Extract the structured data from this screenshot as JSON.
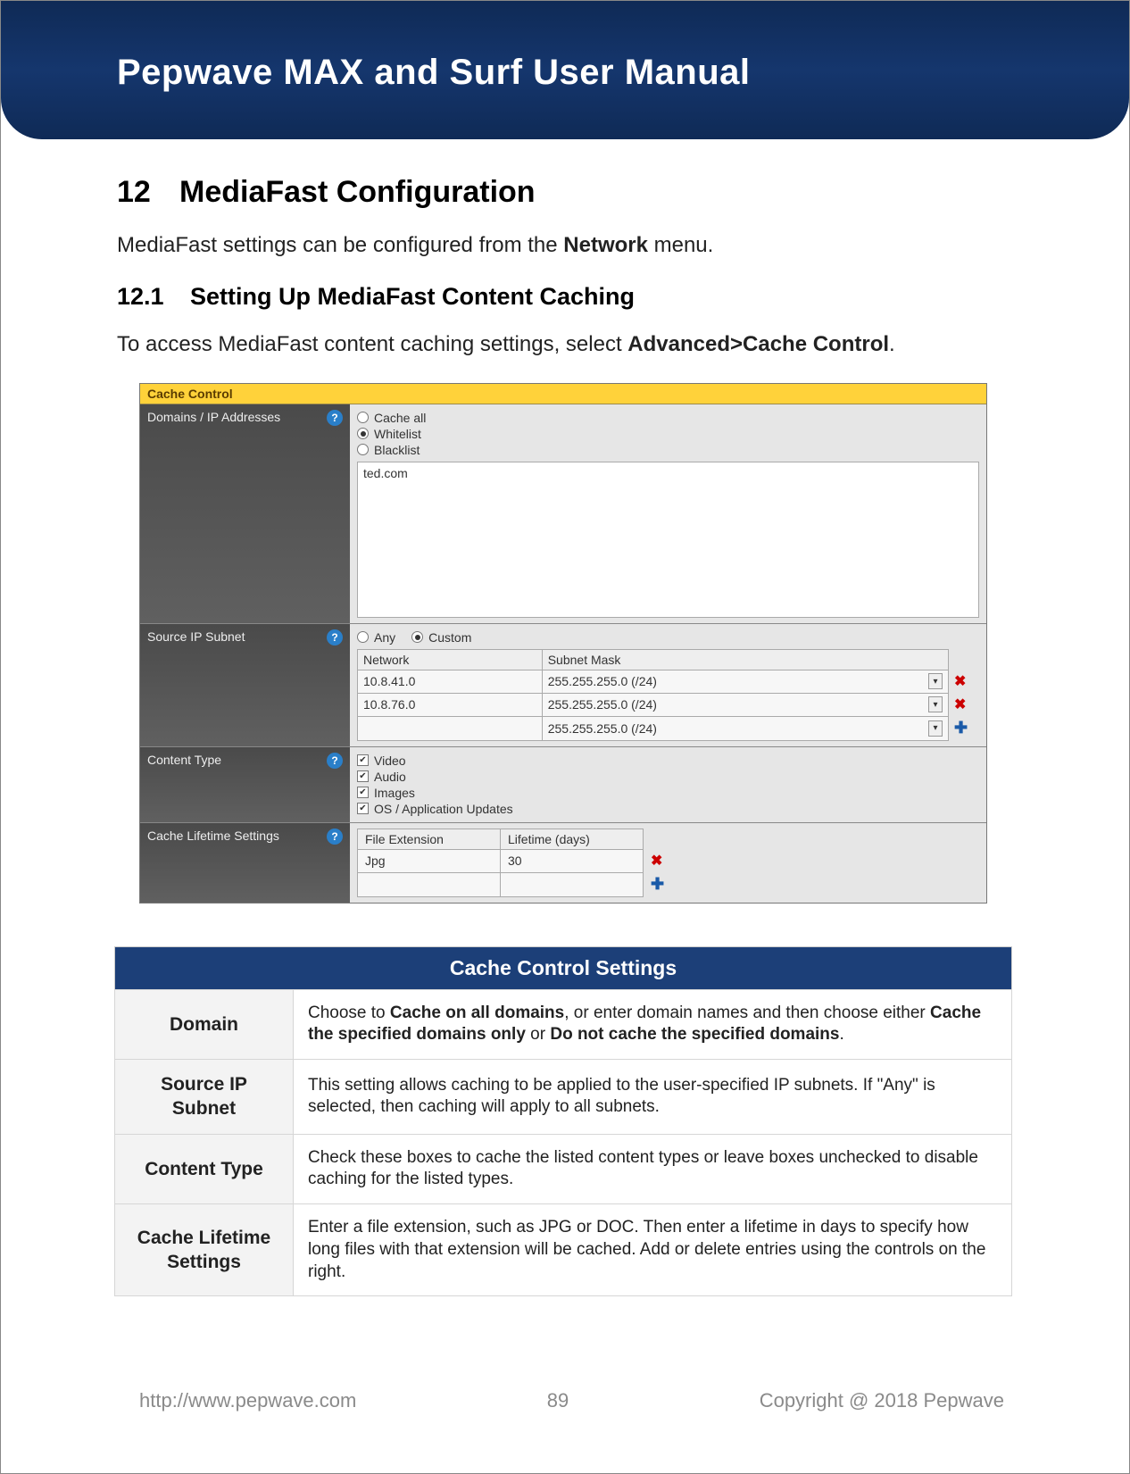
{
  "header": {
    "title": "Pepwave MAX and Surf User Manual"
  },
  "section": {
    "number": "12",
    "title": "MediaFast Configuration",
    "intro_pre": "MediaFast settings can be configured from the ",
    "intro_bold": "Network",
    "intro_post": " menu."
  },
  "subsection": {
    "number": "12.1",
    "title": "Setting Up MediaFast Content Caching",
    "body_pre": "To access MediaFast content caching settings, select ",
    "body_bold": "Advanced>Cache Control",
    "body_post": "."
  },
  "cache_panel": {
    "title": "Cache Control",
    "rows": {
      "domains": {
        "label": "Domains / IP Addresses",
        "options": [
          "Cache all",
          "Whitelist",
          "Blacklist"
        ],
        "selected": "Whitelist",
        "text": "ted.com"
      },
      "source_ip": {
        "label": "Source IP Subnet",
        "mode_options": [
          "Any",
          "Custom"
        ],
        "mode_selected": "Custom",
        "cols": [
          "Network",
          "Subnet Mask"
        ],
        "rows": [
          {
            "net": "10.8.41.0",
            "mask": "255.255.255.0 (/24)",
            "action": "x"
          },
          {
            "net": "10.8.76.0",
            "mask": "255.255.255.0 (/24)",
            "action": "x"
          },
          {
            "net": "",
            "mask": "255.255.255.0 (/24)",
            "action": "+"
          }
        ]
      },
      "content_type": {
        "label": "Content Type",
        "items": [
          "Video",
          "Audio",
          "Images",
          "OS / Application Updates"
        ]
      },
      "lifetime": {
        "label": "Cache Lifetime Settings",
        "cols": [
          "File Extension",
          "Lifetime (days)"
        ],
        "rows": [
          {
            "ext": "Jpg",
            "days": "30",
            "action": "x"
          },
          {
            "ext": "",
            "days": "",
            "action": "+"
          }
        ]
      }
    }
  },
  "desc_table": {
    "title": "Cache Control Settings",
    "rows": [
      {
        "k": "Domain",
        "v_pre": "Choose to ",
        "v_b1": "Cache on all domains",
        "v_mid": ", or enter domain names and then choose either ",
        "v_b2": "Cache the specified domains only",
        "v_mid2": " or ",
        "v_b3": "Do not cache the specified domains",
        "v_post": "."
      },
      {
        "k": "Source IP Subnet",
        "v": "This setting allows caching to be applied to the user-specified IP subnets. If \"Any\" is selected, then caching will apply to all subnets."
      },
      {
        "k": "Content Type",
        "v": "Check these boxes to cache the listed content types or leave boxes unchecked to disable caching for the listed types."
      },
      {
        "k": "Cache Lifetime Settings",
        "v": "Enter a file extension, such as JPG or DOC. Then enter a lifetime in days to specify how long files with that extension will be cached. Add or delete entries using the controls on the right."
      }
    ]
  },
  "footer": {
    "url": "http://www.pepwave.com",
    "page": "89",
    "copyright": "Copyright @ 2018 Pepwave"
  }
}
